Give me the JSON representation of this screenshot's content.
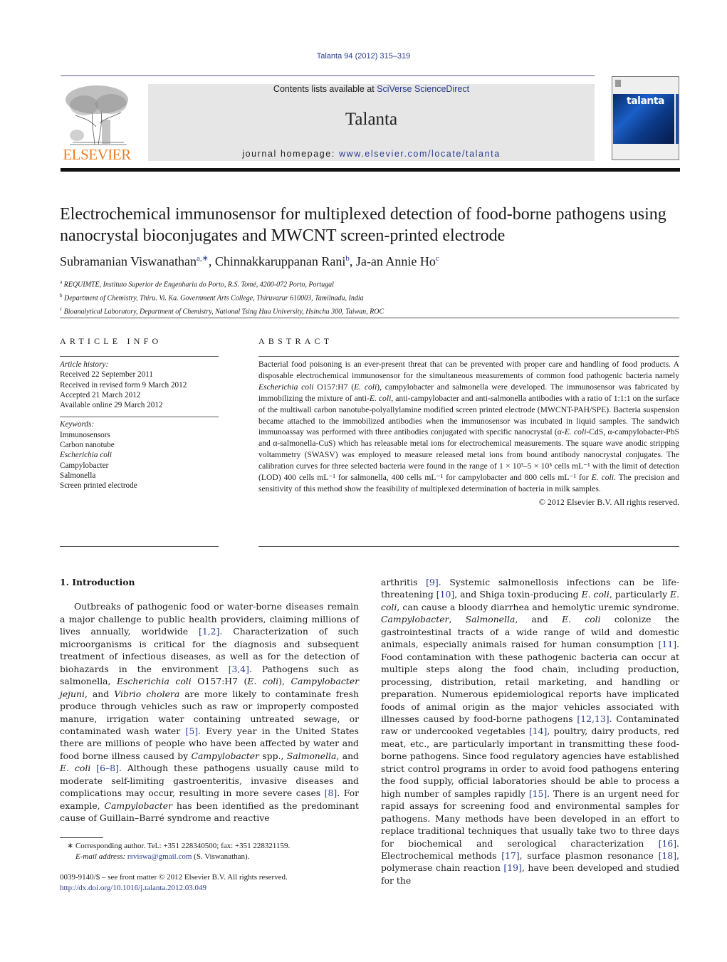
{
  "header": {
    "journal_ref": "Talanta 94 (2012) 315–319",
    "contents_prefix": "Contents lists available at ",
    "contents_link": "SciVerse ScienceDirect",
    "journal_title": "Talanta",
    "homepage_prefix": "journal homepage: ",
    "homepage_link": "www.elsevier.com/locate/talanta",
    "publisher_logo_text": "ELSEVIER",
    "cover_title": "talanta",
    "colors": {
      "link": "#2a3b8f",
      "publisher_orange": "#f07c1e",
      "banner_bg": "#e6e6e6"
    }
  },
  "article": {
    "title": "Electrochemical immunosensor for multiplexed detection of food-borne pathogens using nanocrystal bioconjugates and MWCNT screen-printed electrode",
    "authors": [
      {
        "name": "Subramanian Viswanathan",
        "sup": "a,∗"
      },
      {
        "name": "Chinnakkaruppanan Rani",
        "sup": "b"
      },
      {
        "name": "Ja-an Annie Ho",
        "sup": "c"
      }
    ],
    "affiliations": [
      {
        "sup": "a",
        "text": "REQUIMTE, Instituto Superior de Engenharia do Porto, R.S. Tomé, 4200-072 Porto, Portugal"
      },
      {
        "sup": "b",
        "text": "Department of Chemistry, Thiru. Vi. Ka. Government Arts College, Thiruvarur 610003, Tamilnadu, India"
      },
      {
        "sup": "c",
        "text": "Bioanalytical Laboratory, Department of Chemistry, National Tsing Hua University, Hsinchu 300, Taiwan, ROC"
      }
    ]
  },
  "article_info": {
    "heading": "ARTICLE INFO",
    "history_label": "Article history:",
    "history": [
      "Received 22 September 2011",
      "Received in revised form 9 March 2012",
      "Accepted 21 March 2012",
      "Available online 29 March 2012"
    ],
    "keywords_label": "Keywords:",
    "keywords": [
      "Immunosensors",
      "Carbon nanotube",
      "Escherichia coli",
      "Campylobacter",
      "Salmonella",
      "Screen printed electrode"
    ]
  },
  "abstract": {
    "heading": "ABSTRACT",
    "p1": "Bacterial food poisoning is an ever-present threat that can be prevented with proper care and handling of food products. A disposable electrochemical immunosensor for the simultaneous measurements of common food pathogenic bacteria namely ",
    "p1_i1": "Escherichia coli",
    "p2": " O157:H7 (",
    "p2_i": "E. coli",
    "p3": "), campylobacter and salmonella were developed. The immunosensor was fabricated by immobilizing the mixture of anti-",
    "p3_i": "E. coli",
    "p4": ", anti-campylobacter and anti-salmonella antibodies with a ratio of 1:1:1 on the surface of the multiwall carbon nanotube-polyallylamine modified screen printed electrode (MWCNT-PAH/SPE). Bacteria suspension became attached to the immobilized antibodies when the immunosensor was incubated in liquid samples. The sandwich immunoassay was performed with three antibodies conjugated with specific nanocrystal (α-",
    "p4_i": "E. coli",
    "p5": "-CdS, α-campylobacter-PbS and α-salmonella-CuS) which has releasable metal ions for electrochemical measurements. The square wave anodic stripping voltammetry (SWASV) was employed to measure released metal ions from bound antibody nanocrystal conjugates. The calibration curves for three selected bacteria were found in the range of 1 × 10³–5 × 10⁵ cells mL⁻¹ with the limit of detection (LOD) 400 cells mL⁻¹ for salmonella, 400 cells mL⁻¹ for campylobacter and 800 cells mL⁻¹ for ",
    "p5_i": "E. coli",
    "p6": ". The precision and sensitivity of this method show the feasibility of multiplexed determination of bacteria in milk samples.",
    "copyright": "© 2012 Elsevier B.V. All rights reserved."
  },
  "introduction": {
    "heading": "1.  Introduction",
    "col1": [
      {
        "t": "Outbreaks of pathogenic food or water-borne diseases remain a major challenge to public health providers, claiming millions of lives annually, worldwide "
      },
      {
        "c": "[1,2]"
      },
      {
        "t": ". Characterization of such microorganisms is critical for the diagnosis and subsequent treatment of infectious diseases, as well as for the detection of biohazards in the environment "
      },
      {
        "c": "[3,4]"
      },
      {
        "t": ". Pathogens such as salmonella, "
      },
      {
        "i": "Escherichia coli"
      },
      {
        "t": " O157:H7 ("
      },
      {
        "i": "E. coli"
      },
      {
        "t": "), "
      },
      {
        "i": "Campylobacter jejuni"
      },
      {
        "t": ", and "
      },
      {
        "i": "Vibrio cholera"
      },
      {
        "t": " are more likely to contaminate fresh produce through vehicles such as raw or improperly composted manure, irrigation water containing untreated sewage, or contaminated wash water "
      },
      {
        "c": "[5]"
      },
      {
        "t": ". Every year in the United States there are millions of people who have been affected by water and food borne illness caused by "
      },
      {
        "i": "Campylobacter"
      },
      {
        "t": " spp., "
      },
      {
        "i": "Salmonella"
      },
      {
        "t": ", and "
      },
      {
        "i": "E. coli"
      },
      {
        "t": " "
      },
      {
        "c": "[6–8]"
      },
      {
        "t": ". Although these pathogens usually cause mild to moderate self-limiting gastroenteritis, invasive diseases and complications may occur, resulting in more severe cases "
      },
      {
        "c": "[8]"
      },
      {
        "t": ". For example, "
      },
      {
        "i": "Campylobacter"
      },
      {
        "t": " has been identified as the predominant cause of Guillain–Barré syndrome and reactive"
      }
    ],
    "col2": [
      {
        "t": "arthritis "
      },
      {
        "c": "[9]"
      },
      {
        "t": ". Systemic salmonellosis infections can be life-threatening "
      },
      {
        "c": "[10]"
      },
      {
        "t": ", and Shiga toxin-producing "
      },
      {
        "i": "E. coli"
      },
      {
        "t": ", particularly "
      },
      {
        "i": "E. coli"
      },
      {
        "t": ", can cause a bloody diarrhea and hemolytic uremic syndrome. "
      },
      {
        "i": "Campylobacter"
      },
      {
        "t": ", "
      },
      {
        "i": "Salmonella"
      },
      {
        "t": ", and "
      },
      {
        "i": "E. coli"
      },
      {
        "t": " colonize the gastrointestinal tracts of a wide range of wild and domestic animals, especially animals raised for human consumption "
      },
      {
        "c": "[11]"
      },
      {
        "t": ". Food contamination with these pathogenic bacteria can occur at multiple steps along the food chain, including production, processing, distribution, retail marketing, and handling or preparation. Numerous epidemiological reports have implicated foods of animal origin as the major vehicles associated with illnesses caused by food-borne pathogens "
      },
      {
        "c": "[12,13]"
      },
      {
        "t": ". Contaminated raw or undercooked vegetables "
      },
      {
        "c": "[14]"
      },
      {
        "t": ", poultry, dairy products, red meat, etc., are particularly important in transmitting these food-borne pathogens. Since food regulatory agencies have established strict control programs in order to avoid food pathogens entering the food supply, official laboratories should be able to process a high number of samples rapidly "
      },
      {
        "c": "[15]"
      },
      {
        "t": ". There is an urgent need for rapid assays for screening food and environmental samples for pathogens. Many methods have been developed in an effort to replace traditional techniques that usually take two to three days for biochemical and serological characterization "
      },
      {
        "c": "[16]"
      },
      {
        "t": ". Electrochemical methods "
      },
      {
        "c": "[17]"
      },
      {
        "t": ", surface plasmon resonance "
      },
      {
        "c": "[18]"
      },
      {
        "t": ", polymerase chain reaction "
      },
      {
        "c": "[19]"
      },
      {
        "t": ", have been developed and studied for the"
      }
    ]
  },
  "footnote": {
    "star": "∗",
    "corresponding": "Corresponding author. Tel.: +351 228340500; fax: +351 228321159.",
    "email_label": "E-mail address:",
    "email": "rsviswa@gmail.com",
    "email_suffix": " (S. Viswanathan)."
  },
  "front_matter": {
    "issn_line": "0039-9140/$ – see front matter © 2012 Elsevier B.V. All rights reserved.",
    "doi": "http://dx.doi.org/10.1016/j.talanta.2012.03.049"
  }
}
